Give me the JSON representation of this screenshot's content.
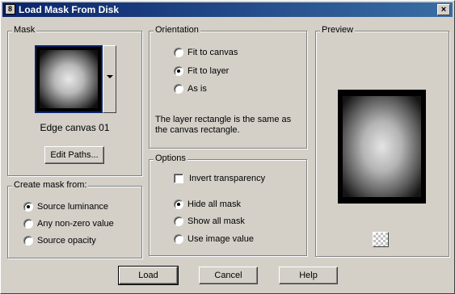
{
  "window": {
    "title": "Load Mask From Disk",
    "close_glyph": "×"
  },
  "mask": {
    "legend": "Mask",
    "name": "Edge canvas 01",
    "edit_paths_label": "Edit Paths..."
  },
  "create_mask": {
    "legend": "Create mask from:",
    "options": [
      {
        "label": "Source luminance",
        "selected": true
      },
      {
        "label": "Any non-zero value",
        "selected": false
      },
      {
        "label": "Source opacity",
        "selected": false
      }
    ]
  },
  "orientation": {
    "legend": "Orientation",
    "options": [
      {
        "label": "Fit to canvas",
        "selected": false
      },
      {
        "label": "Fit to layer",
        "selected": true
      },
      {
        "label": "As is",
        "selected": false
      }
    ],
    "description": "The layer rectangle is the same as the canvas rectangle."
  },
  "options": {
    "legend": "Options",
    "invert_label": "Invert transparency",
    "invert_checked": false,
    "radios": [
      {
        "label": "Hide all mask",
        "selected": true
      },
      {
        "label": "Show all mask",
        "selected": false
      },
      {
        "label": "Use image value",
        "selected": false
      }
    ]
  },
  "preview": {
    "legend": "Preview"
  },
  "buttons": {
    "load": "Load",
    "cancel": "Cancel",
    "help": "Help"
  }
}
